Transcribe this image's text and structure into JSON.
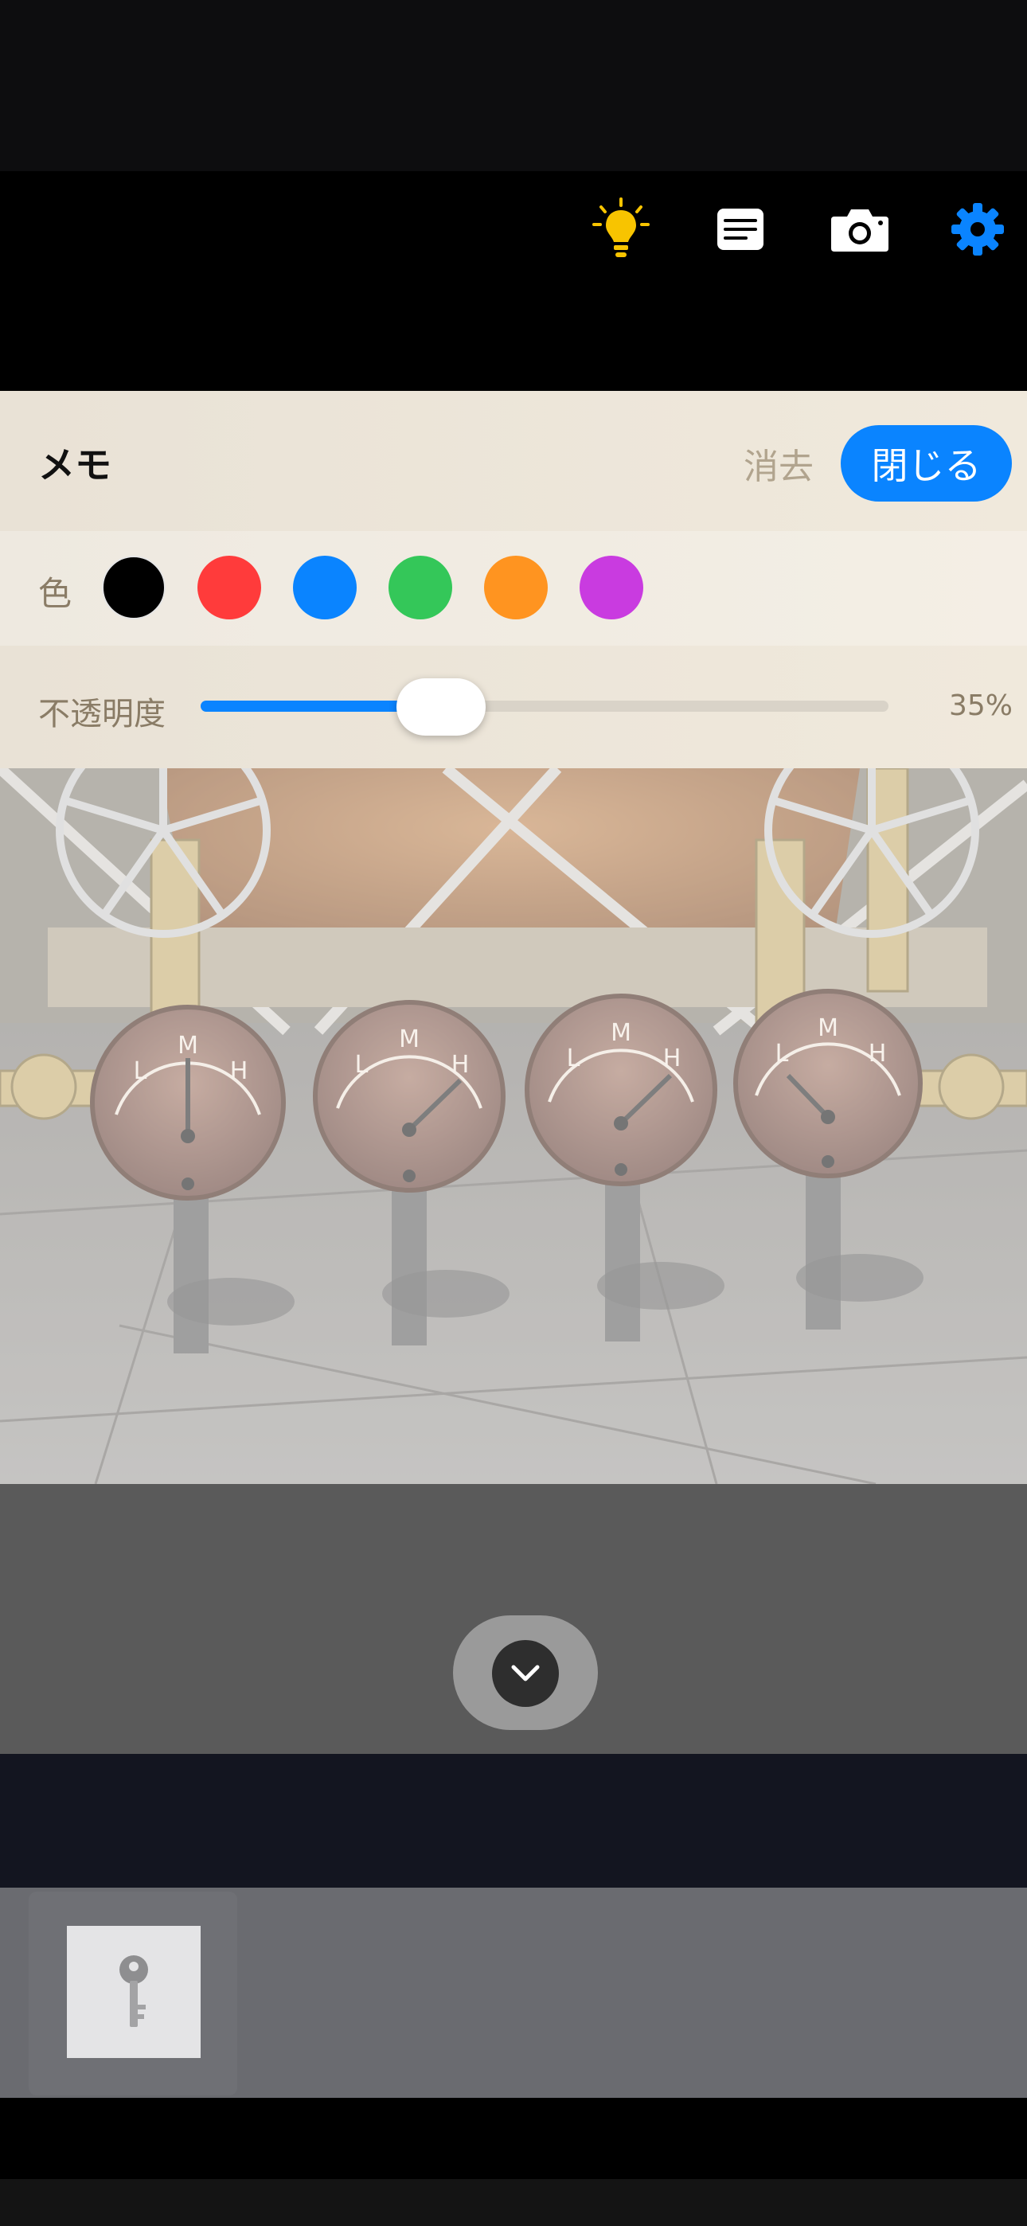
{
  "toolbar": {
    "icons": [
      "lightbulb-icon",
      "memo-icon",
      "camera-icon",
      "settings-gear-icon"
    ],
    "colors": {
      "lightbulb": "#f8c400",
      "icon": "#ffffff",
      "gear": "#0a84ff"
    }
  },
  "memo": {
    "title": "メモ",
    "clear_label": "消去",
    "close_label": "閉じる",
    "color_label": "色",
    "colors": [
      "#000000",
      "#ff3b3b",
      "#0a84ff",
      "#34c759",
      "#ff9420",
      "#c93be0"
    ],
    "selected_color": "#000000",
    "opacity_label": "不透明度",
    "opacity_value": "35%",
    "opacity_fraction": 0.35
  },
  "scene": {
    "gauges": [
      {
        "l": "L",
        "m": "M",
        "h": "H"
      },
      {
        "l": "L",
        "m": "M",
        "h": "H"
      },
      {
        "l": "L",
        "m": "M",
        "h": "H"
      },
      {
        "l": "L",
        "m": "M",
        "h": "H"
      }
    ]
  },
  "inventory": {
    "items": [
      "key-icon"
    ]
  }
}
